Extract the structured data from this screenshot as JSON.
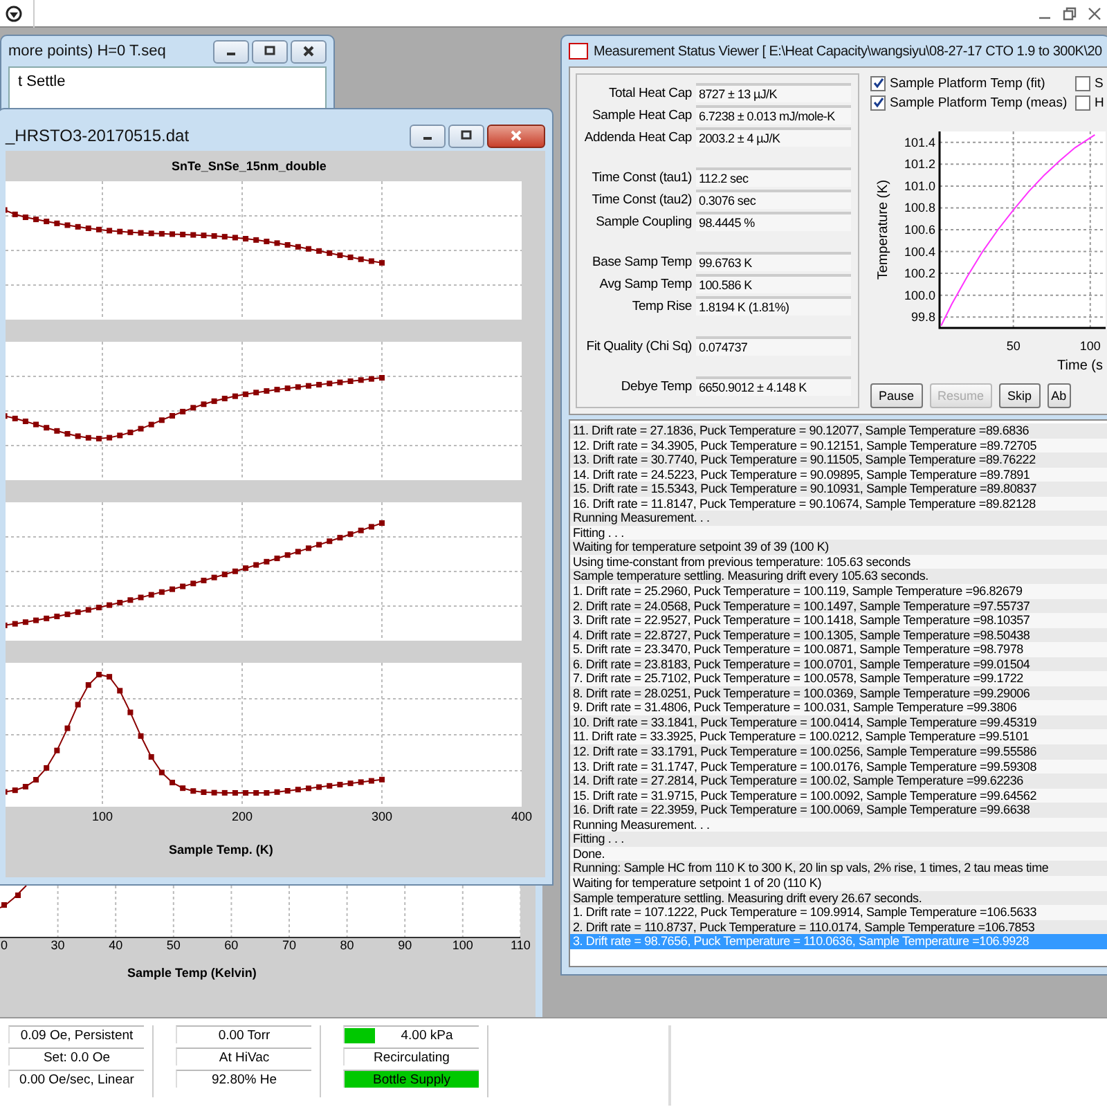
{
  "sequence_window": {
    "title": "more points) H=0 T.seq",
    "lines": [
      "t Settle"
    ]
  },
  "plot_window": {
    "title": "_HRSTO3-20170515.dat",
    "plot_title": "SnTe_SnSe_15nm_double",
    "x_ticks": [
      "100",
      "200",
      "300",
      "400"
    ],
    "x_label": "Sample Temp. (K)"
  },
  "back_plot": {
    "x_ticks": [
      "0",
      "30",
      "40",
      "50",
      "60",
      "70",
      "80",
      "90",
      "100",
      "110"
    ],
    "x_label": "Sample Temp (Kelvin)"
  },
  "status_viewer": {
    "title": "Measurement Status Viewer [ E:\\Heat Capacity\\wangsiyu\\08-27-17 CTO 1.9 to 300K\\20",
    "field_groups": [
      [
        {
          "label": "Total Heat Cap",
          "value": "8727 ± 13 µJ/K"
        },
        {
          "label": "Sample Heat Cap",
          "value": "6.7238 ± 0.013 mJ/mole-K"
        },
        {
          "label": "Addenda Heat Cap",
          "value": "2003.2 ± 4 µJ/K"
        }
      ],
      [
        {
          "label": "Time Const (tau1)",
          "value": "112.2 sec"
        },
        {
          "label": "Time Const (tau2)",
          "value": "0.3076 sec"
        },
        {
          "label": "Sample Coupling",
          "value": "98.4445 %"
        }
      ],
      [
        {
          "label": "Base Samp Temp",
          "value": "99.6763 K"
        },
        {
          "label": "Avg Samp Temp",
          "value": "100.586 K"
        },
        {
          "label": "Temp Rise",
          "value": "1.8194 K  (1.81%)"
        }
      ],
      [
        {
          "label": "Fit Quality (Chi Sq)",
          "value": "0.074737"
        }
      ],
      [
        {
          "label": "Debye Temp",
          "value": "6650.9012 ± 4.148 K"
        }
      ]
    ],
    "checkboxes": [
      {
        "label": "Sample Platform Temp (fit)",
        "checked": true
      },
      {
        "label": "Sample Platform Temp (meas)",
        "checked": true
      },
      {
        "label": "S",
        "checked": false
      },
      {
        "label": "H",
        "checked": false
      }
    ],
    "chart_data": {
      "type": "line",
      "grid": true,
      "xlabel": "Time (s",
      "ylabel": "Temperature (K)",
      "x": [
        3,
        10,
        20,
        30,
        40,
        50,
        60,
        70,
        80,
        90,
        103
      ],
      "series": [
        {
          "color": "#ff33ff",
          "values": [
            99.72,
            99.92,
            100.17,
            100.4,
            100.6,
            100.78,
            100.95,
            101.1,
            101.23,
            101.35,
            101.47
          ]
        }
      ],
      "xlim": [
        2,
        110
      ],
      "ylim": [
        99.7,
        101.5
      ],
      "xticks": [
        50,
        100
      ],
      "yticks": [
        {
          "value": 99.8,
          "label": "99.8"
        },
        {
          "value": 100.0,
          "label": "100.0"
        },
        {
          "value": 100.2,
          "label": "100.2"
        },
        {
          "value": 100.4,
          "label": "100.4"
        },
        {
          "value": 100.6,
          "label": "100.6"
        },
        {
          "value": 100.8,
          "label": "100.8"
        },
        {
          "value": 101.0,
          "label": "101.0"
        },
        {
          "value": 101.2,
          "label": "101.2"
        },
        {
          "value": 101.4,
          "label": "101.4"
        }
      ]
    },
    "buttons": [
      {
        "label": "Pause",
        "disabled": false
      },
      {
        "label": "Resume",
        "disabled": true
      },
      {
        "label": "Skip",
        "disabled": false
      },
      {
        "label": "Ab",
        "disabled": false
      }
    ],
    "log": [
      {
        "text": "11. Drift rate = 27.1836, Puck Temperature = 90.12077, Sample Temperature =89.6836",
        "selected": false
      },
      {
        "text": "12. Drift rate = 34.3905, Puck Temperature = 90.12151, Sample Temperature =89.72705",
        "selected": false
      },
      {
        "text": "13. Drift rate = 30.7740, Puck Temperature = 90.11505, Sample Temperature =89.76222",
        "selected": false
      },
      {
        "text": "14. Drift rate = 24.5223, Puck Temperature = 90.09895, Sample Temperature =89.7891",
        "selected": false
      },
      {
        "text": "15. Drift rate = 15.5343, Puck Temperature = 90.10931, Sample Temperature =89.80837",
        "selected": false
      },
      {
        "text": "16. Drift rate = 11.8147, Puck Temperature = 90.10674, Sample Temperature =89.82128",
        "selected": false
      },
      {
        "text": "Running Measurement. . .",
        "selected": false
      },
      {
        "text": "Fitting . . .",
        "selected": false
      },
      {
        "text": "Waiting for temperature setpoint 39 of 39 (100 K)",
        "selected": false
      },
      {
        "text": "Using time-constant from previous temperature: 105.63 seconds",
        "selected": false
      },
      {
        "text": "Sample temperature settling.  Measuring drift every 105.63 seconds.",
        "selected": false
      },
      {
        "text": "1. Drift rate = 25.2960, Puck Temperature = 100.119, Sample Temperature =96.82679",
        "selected": false
      },
      {
        "text": "2. Drift rate = 24.0568, Puck Temperature = 100.1497, Sample Temperature =97.55737",
        "selected": false
      },
      {
        "text": "3. Drift rate = 22.9527, Puck Temperature = 100.1418, Sample Temperature =98.10357",
        "selected": false
      },
      {
        "text": "4. Drift rate = 22.8727, Puck Temperature = 100.1305, Sample Temperature =98.50438",
        "selected": false
      },
      {
        "text": "5. Drift rate = 23.3470, Puck Temperature = 100.0871, Sample Temperature =98.7978",
        "selected": false
      },
      {
        "text": "6. Drift rate = 23.8183, Puck Temperature = 100.0701, Sample Temperature =99.01504",
        "selected": false
      },
      {
        "text": "7. Drift rate = 25.7102, Puck Temperature = 100.0578, Sample Temperature =99.1722",
        "selected": false
      },
      {
        "text": "8. Drift rate = 28.0251, Puck Temperature = 100.0369, Sample Temperature =99.29006",
        "selected": false
      },
      {
        "text": "9. Drift rate = 31.4806, Puck Temperature = 100.031, Sample Temperature =99.3806",
        "selected": false
      },
      {
        "text": "10. Drift rate = 33.1841, Puck Temperature = 100.0414, Sample Temperature =99.45319",
        "selected": false
      },
      {
        "text": "11. Drift rate = 33.3925, Puck Temperature = 100.0212, Sample Temperature =99.5101",
        "selected": false
      },
      {
        "text": "12. Drift rate = 33.1791, Puck Temperature = 100.0256, Sample Temperature =99.55586",
        "selected": false
      },
      {
        "text": "13. Drift rate = 31.1747, Puck Temperature = 100.0176, Sample Temperature =99.59308",
        "selected": false
      },
      {
        "text": "14. Drift rate = 27.2814, Puck Temperature = 100.02, Sample Temperature =99.62236",
        "selected": false
      },
      {
        "text": "15. Drift rate = 31.9715, Puck Temperature = 100.0092, Sample Temperature =99.64562",
        "selected": false
      },
      {
        "text": "16. Drift rate = 22.3959, Puck Temperature = 100.0069, Sample Temperature =99.6638",
        "selected": false
      },
      {
        "text": "Running Measurement. . .",
        "selected": false
      },
      {
        "text": "Fitting . . .",
        "selected": false
      },
      {
        "text": "Done.",
        "selected": false
      },
      {
        "text": "Running: Sample HC from 110 K to 300 K, 20 lin sp vals, 2% rise, 1 times, 2 tau meas time",
        "selected": false
      },
      {
        "text": "Waiting for temperature setpoint 1 of 20 (110 K)",
        "selected": false
      },
      {
        "text": "Sample temperature settling.  Measuring drift every 26.67 seconds.",
        "selected": false
      },
      {
        "text": "1. Drift rate = 107.1222, Puck Temperature = 109.9914, Sample Temperature =106.5633",
        "selected": false
      },
      {
        "text": "2. Drift rate = 110.8737, Puck Temperature = 110.0174, Sample Temperature =106.7853",
        "selected": false
      },
      {
        "text": "3. Drift rate = 98.7656, Puck Temperature = 110.0636, Sample Temperature =106.9928",
        "selected": true
      }
    ]
  },
  "status_bar": {
    "panels": [
      {
        "items": [
          {
            "text": "0.09 Oe, Persistent",
            "kind": "plain"
          },
          {
            "text": "Set: 0.0 Oe",
            "kind": "plain"
          },
          {
            "text": "0.00 Oe/sec, Linear",
            "kind": "plain"
          }
        ]
      },
      {
        "items": [
          {
            "text": "0.00 Torr",
            "kind": "plain"
          },
          {
            "text": "At HiVac",
            "kind": "plain"
          },
          {
            "text": "92.80% He",
            "kind": "plain"
          }
        ]
      },
      {
        "items": [
          {
            "text": "4.00 kPa",
            "kind": "swatch"
          },
          {
            "text": "Recirculating",
            "kind": "plain"
          },
          {
            "text": "Bottle Supply",
            "kind": "highlight"
          }
        ]
      }
    ]
  }
}
